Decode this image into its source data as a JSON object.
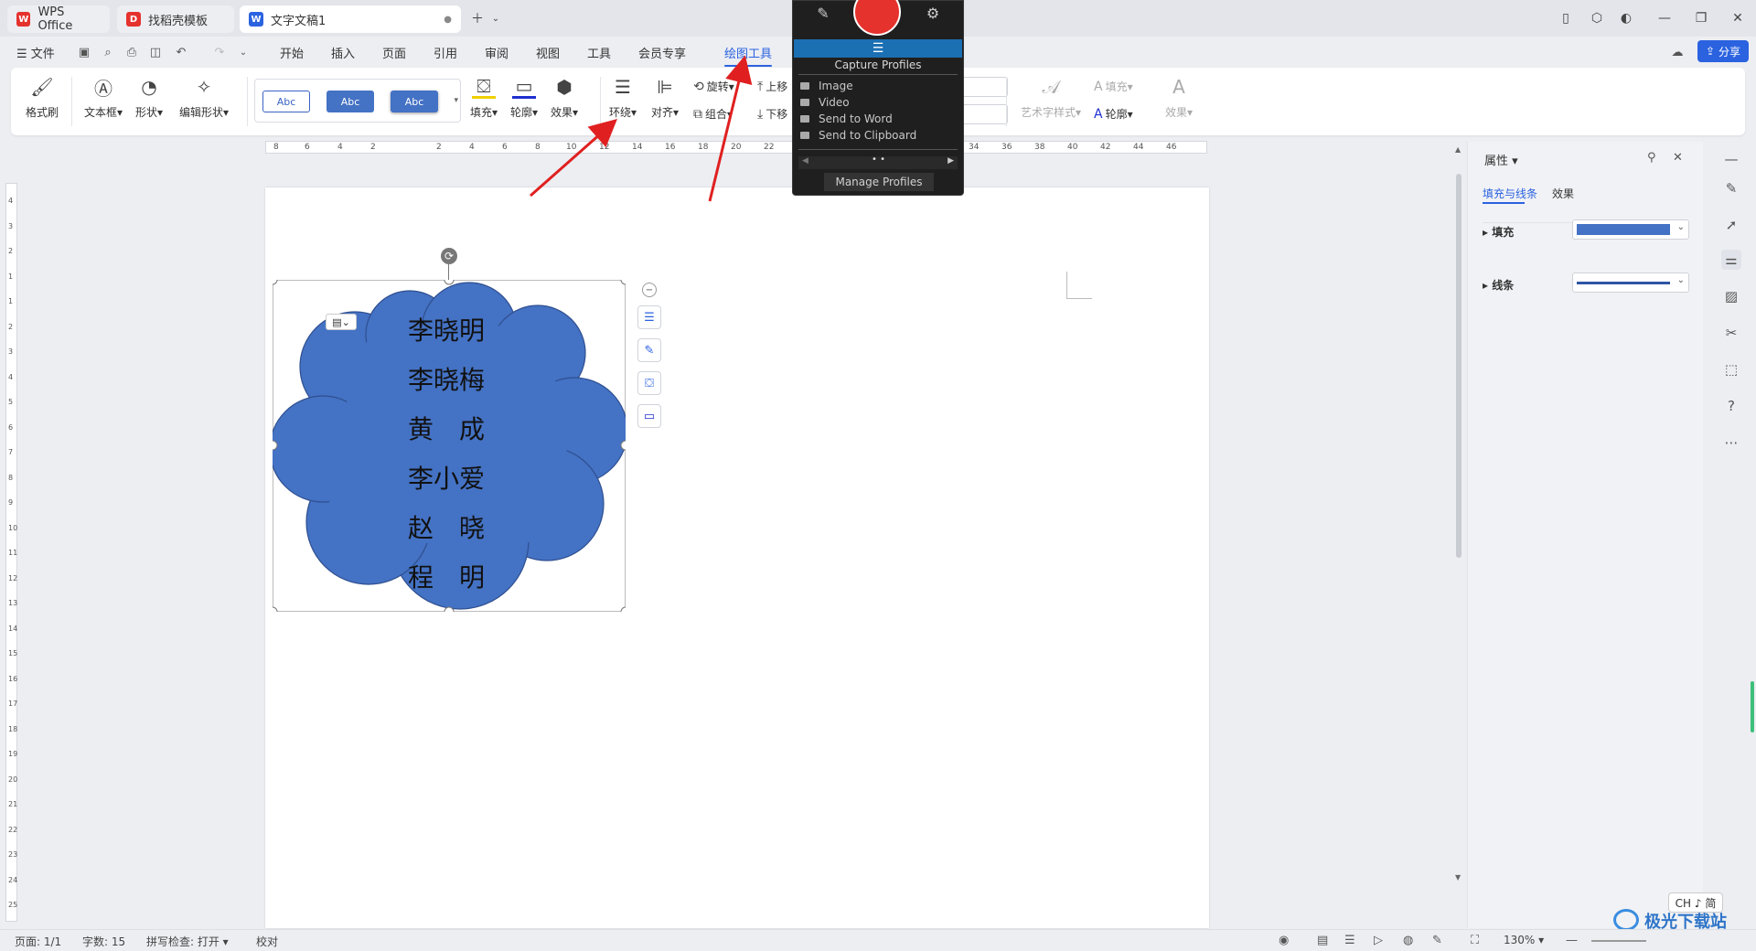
{
  "tabs": [
    {
      "label": "WPS Office",
      "icon": "wps-logo-icon"
    },
    {
      "label": "找稻壳模板",
      "icon": "docer-icon"
    },
    {
      "label": "文字文稿1",
      "icon": "word-doc-icon"
    }
  ],
  "menu": {
    "file": "文件",
    "items": [
      "开始",
      "插入",
      "页面",
      "引用",
      "审阅",
      "视图",
      "工具",
      "会员专享",
      "绘图工具"
    ],
    "active": "绘图工具",
    "share": "分享"
  },
  "ribbon": {
    "format_painter": "格式刷",
    "textbox": "文本框",
    "shape": "形状",
    "edit_shape": "编辑形状",
    "style_samples": [
      "Abc",
      "Abc",
      "Abc"
    ],
    "fill": "填充",
    "outline": "轮廓",
    "effect": "效果",
    "wrap": "环绕",
    "align": "对齐",
    "rotate": "旋转",
    "group": "组合",
    "bring_forward": "上移",
    "send_backward": "下移",
    "art_style": "艺术字样式",
    "text_fill": "填充",
    "text_outline": "轮廓",
    "text_effect": "效果"
  },
  "ruler": {
    "h_ticks": [
      "8",
      "6",
      "4",
      "2",
      "2",
      "4",
      "6",
      "8",
      "10",
      "12",
      "14",
      "16",
      "18",
      "20",
      "22",
      "34",
      "36",
      "38",
      "40",
      "42",
      "44",
      "46"
    ],
    "v_ticks": [
      "4",
      "3",
      "2",
      "1",
      "1",
      "2",
      "3",
      "4",
      "5",
      "6",
      "7",
      "8",
      "9",
      "10",
      "11",
      "12",
      "13",
      "14",
      "15",
      "16",
      "17",
      "18",
      "19",
      "20",
      "21",
      "22",
      "23",
      "24",
      "25"
    ]
  },
  "document": {
    "names": [
      "李晓明",
      "李晓梅",
      "黄　成",
      "李小爱",
      "赵　晓",
      "程　明"
    ],
    "shape_fill": "#4472c4"
  },
  "capture": {
    "title": "Capture Profiles",
    "items": [
      "Image",
      "Video",
      "Send to Word",
      "Send to Clipboard"
    ],
    "manage": "Manage Profiles"
  },
  "props": {
    "title": "属性",
    "tab_fill_line": "填充与线条",
    "tab_effect": "效果",
    "fill_label": "填充",
    "line_label": "线条",
    "fill_color": "#4472c4",
    "line_color": "#2e55a5"
  },
  "status": {
    "page": "页面: 1/1",
    "words": "字数: 15",
    "spellcheck": "拼写检查: 打开",
    "proof": "校对",
    "zoom": "130%"
  },
  "ime": "CH ♪ 简",
  "watermark": "极光下载站"
}
